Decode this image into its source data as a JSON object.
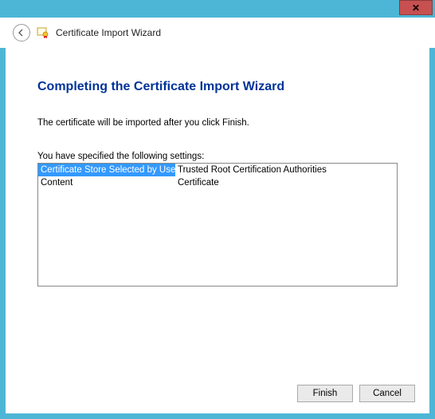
{
  "titlebar": {
    "close_glyph": "✕"
  },
  "header": {
    "title": "Certificate Import Wizard"
  },
  "main": {
    "heading": "Completing the Certificate Import Wizard",
    "body": "The certificate will be imported after you click Finish.",
    "settings_label": "You have specified the following settings:",
    "settings": [
      {
        "key": "Certificate Store Selected by User",
        "value": "Trusted Root Certification Authorities",
        "selected": true
      },
      {
        "key": "Content",
        "value": "Certificate",
        "selected": false
      }
    ]
  },
  "buttons": {
    "finish": "Finish",
    "cancel": "Cancel"
  }
}
